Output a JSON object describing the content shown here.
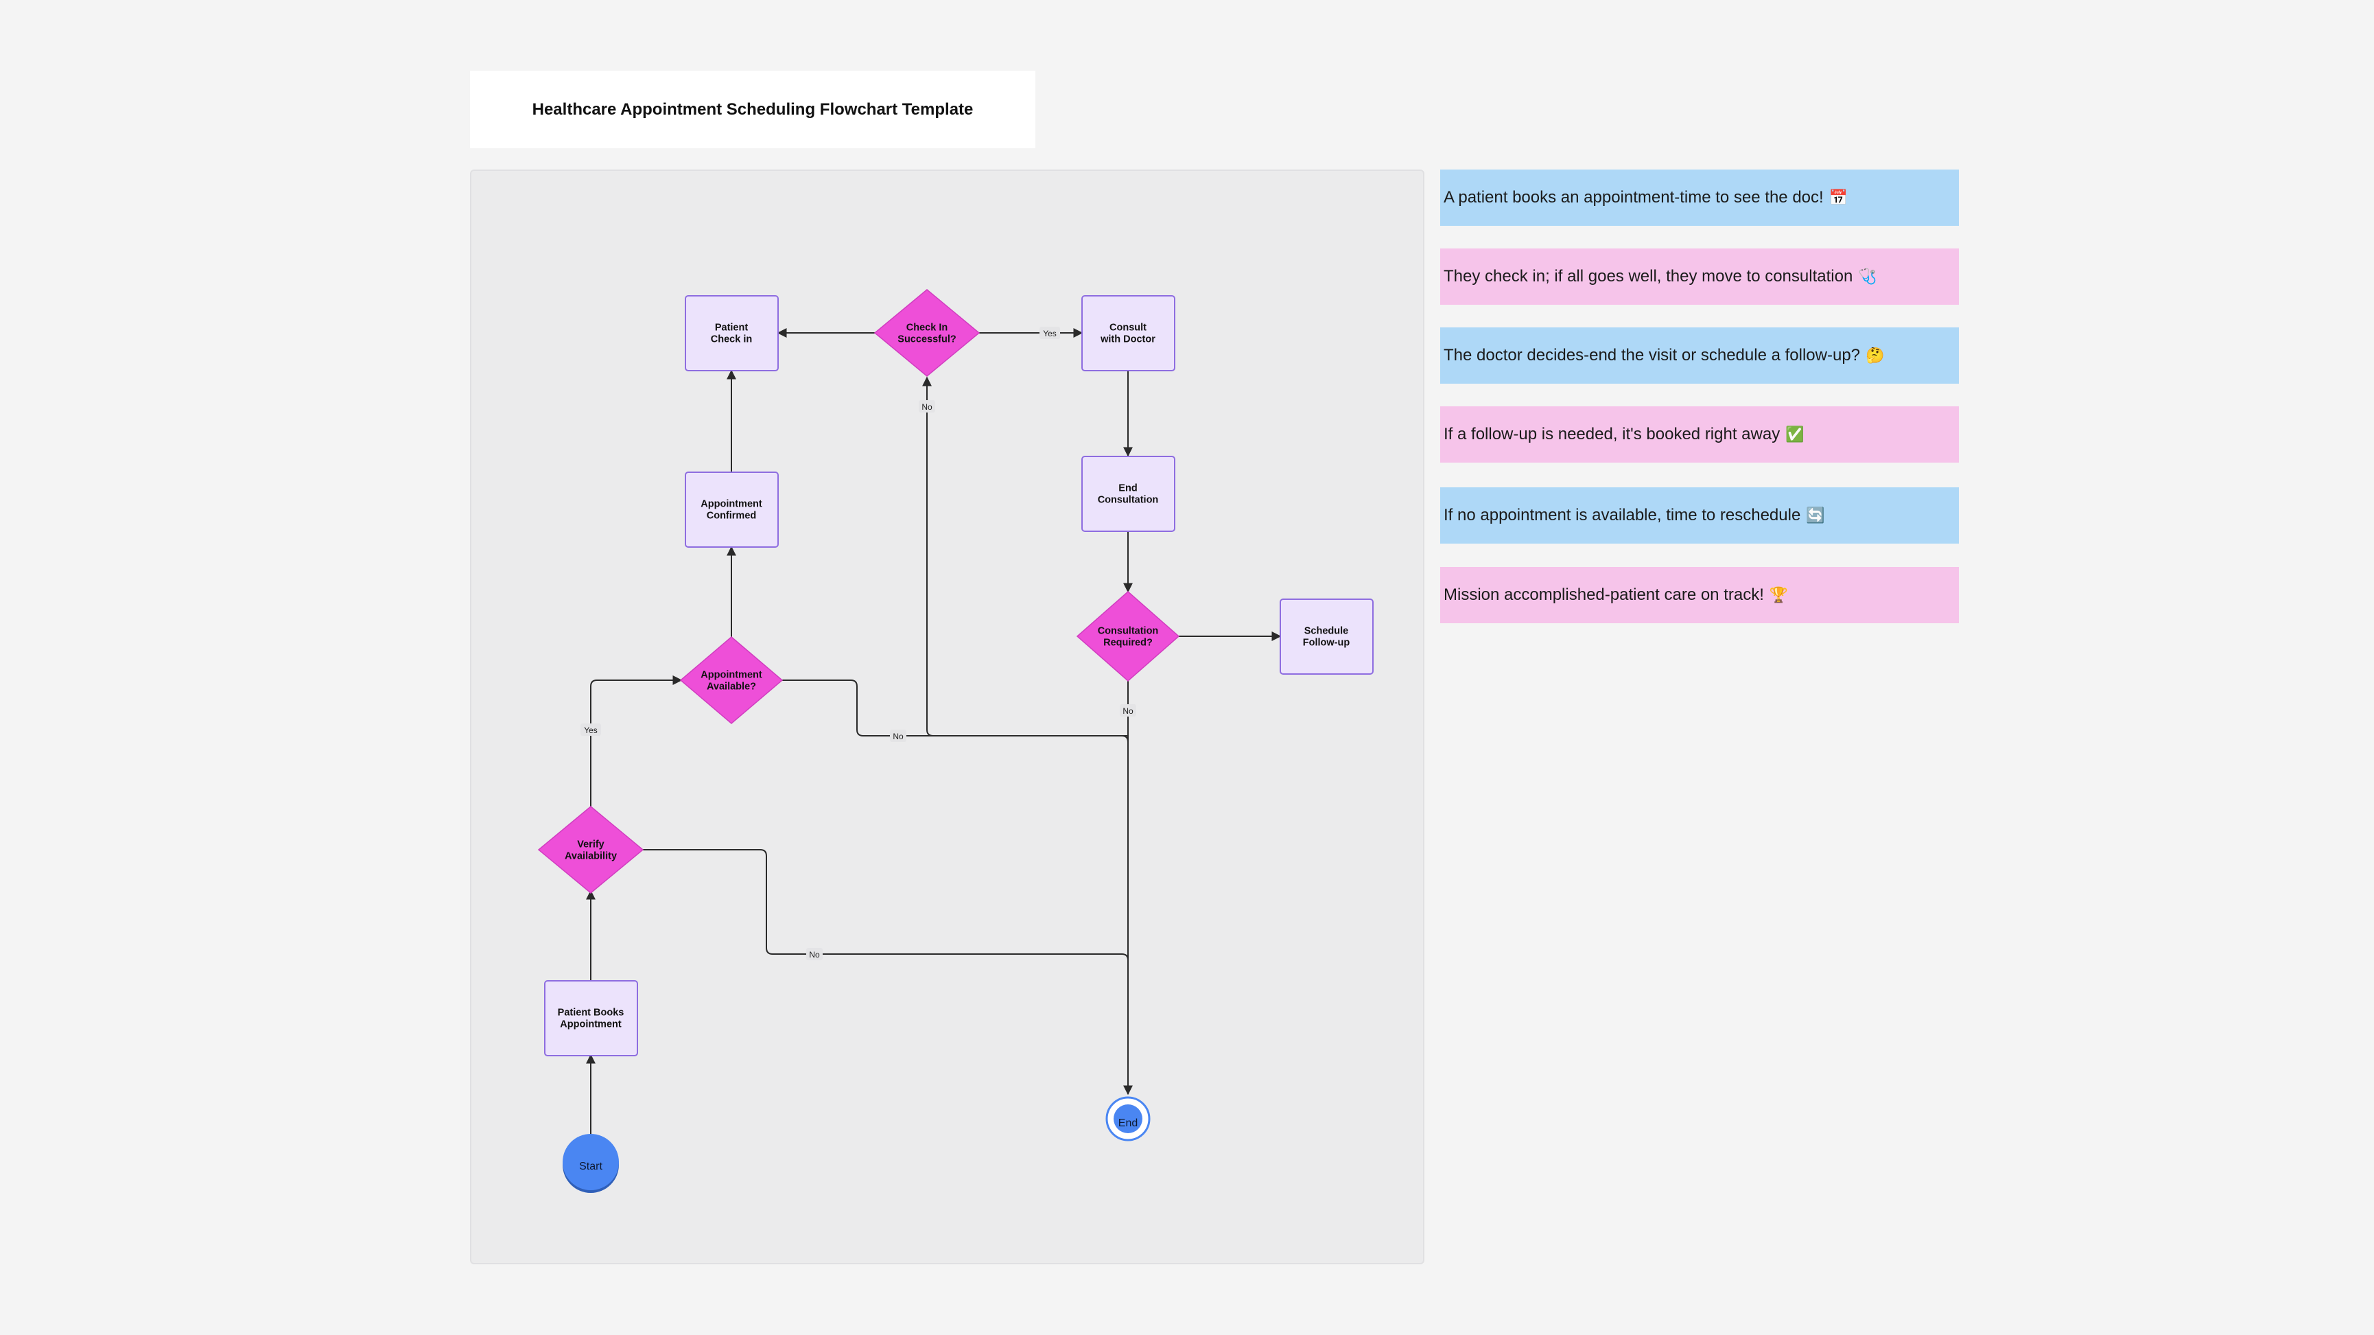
{
  "title": "Healthcare Appointment Scheduling Flowchart Template",
  "colors": {
    "page_bg": "#f4f4f4",
    "canvas_bg": "#ebebec",
    "process_fill": "#ece3fc",
    "process_stroke": "#8e6de0",
    "decision_fill": "#ee4fd8",
    "terminal_fill": "#4a86f2",
    "edge": "#2a2a2a",
    "sticky_blue": "#aed8f7",
    "sticky_pink": "#f6c4ea"
  },
  "nodes": {
    "patient_check_in": "Patient\nCheck in",
    "check_in_successful": "Check In\nSuccessful?",
    "consult_with_doctor": "Consult\nwith Doctor",
    "appointment_confirmed": "Appointment\nConfirmed",
    "end_consultation": "End\nConsultation",
    "consultation_required": "Consultation\nRequired?",
    "schedule_follow_up": "Schedule\nFollow-up",
    "appointment_available": "Appointment\nAvailable?",
    "verify_availability": "Verify\nAvailability",
    "patient_books_appointment": "Patient Books\nAppointment",
    "start": "Start",
    "end": "End"
  },
  "edge_labels": {
    "check_in_yes": "Yes",
    "check_in_no": "No",
    "appointment_available_yes": "Yes",
    "appointment_available_no": "No",
    "consultation_required_no": "No",
    "verify_availability_no": "No"
  },
  "sticky_notes": [
    {
      "text": "A patient books an appointment-time to see the doc!",
      "icon": "calendar-icon",
      "glyph": "📅",
      "color": "blue"
    },
    {
      "text": "They check in; if all goes well, they move to consultation",
      "icon": "stethoscope-icon",
      "glyph": "🩺",
      "color": "pink"
    },
    {
      "text": "The doctor decides-end the visit or schedule a follow-up?",
      "icon": "thinking-face-icon",
      "glyph": "🤔",
      "color": "blue"
    },
    {
      "text": "If a follow-up is needed, it's booked right away",
      "icon": "check-mark-icon",
      "glyph": "✅",
      "color": "pink"
    },
    {
      "text": "If no appointment is available, time to reschedule",
      "icon": "refresh-icon",
      "glyph": "🔄",
      "color": "blue"
    },
    {
      "text": "Mission accomplished-patient care on track!",
      "icon": "trophy-icon",
      "glyph": "🏆",
      "color": "pink"
    }
  ]
}
